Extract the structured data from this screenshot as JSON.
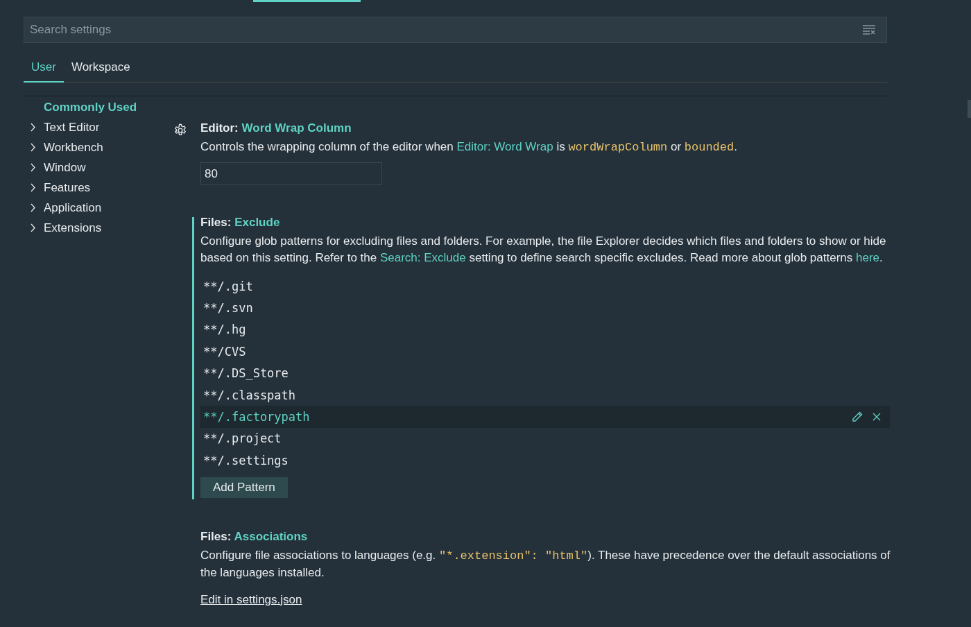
{
  "search": {
    "placeholder": "Search settings"
  },
  "tabs": [
    {
      "label": "User",
      "selected": true
    },
    {
      "label": "Workspace",
      "selected": false
    }
  ],
  "sidebar": {
    "heading": "Commonly Used",
    "items": [
      {
        "label": "Text Editor",
        "expanded": false
      },
      {
        "label": "Workbench",
        "expanded": false
      },
      {
        "label": "Window",
        "expanded": false
      },
      {
        "label": "Features",
        "expanded": false
      },
      {
        "label": "Application",
        "expanded": false
      },
      {
        "label": "Extensions",
        "expanded": false
      }
    ]
  },
  "settings": [
    {
      "kind": "number",
      "category": "Editor:",
      "name": "Word Wrap Column",
      "gear": true,
      "focused": false,
      "description": [
        {
          "kind": "text",
          "text": "Controls the wrapping column of the editor when "
        },
        {
          "kind": "link",
          "text": "Editor: Word Wrap"
        },
        {
          "kind": "text",
          "text": " is "
        },
        {
          "kind": "code",
          "text": "wordWrapColumn"
        },
        {
          "kind": "text",
          "text": " or "
        },
        {
          "kind": "code",
          "text": "bounded"
        },
        {
          "kind": "text",
          "text": "."
        }
      ],
      "value": "80"
    },
    {
      "kind": "list",
      "category": "Files:",
      "name": "Exclude",
      "gear": false,
      "focused": true,
      "description": [
        {
          "kind": "text",
          "text": "Configure glob patterns for excluding files and folders. For example, the file Explorer decides which files and folders to show or hide based on this setting. Refer to the "
        },
        {
          "kind": "link",
          "text": "Search: Exclude"
        },
        {
          "kind": "text",
          "text": " setting to define search specific excludes. Read more about glob patterns "
        },
        {
          "kind": "link",
          "text": "here"
        },
        {
          "kind": "text",
          "text": "."
        }
      ],
      "items": [
        {
          "text": "**/.git",
          "selected": false
        },
        {
          "text": "**/.svn",
          "selected": false
        },
        {
          "text": "**/.hg",
          "selected": false
        },
        {
          "text": "**/CVS",
          "selected": false
        },
        {
          "text": "**/.DS_Store",
          "selected": false
        },
        {
          "text": "**/.classpath",
          "selected": false
        },
        {
          "text": "**/.factorypath",
          "selected": true
        },
        {
          "text": "**/.project",
          "selected": false
        },
        {
          "text": "**/.settings",
          "selected": false
        }
      ],
      "button": "Add Pattern"
    },
    {
      "kind": "json",
      "category": "Files:",
      "name": "Associations",
      "gear": false,
      "focused": false,
      "description": [
        {
          "kind": "text",
          "text": "Configure file associations to languages (e.g. "
        },
        {
          "kind": "code",
          "text": "\"*.extension\": \"html\""
        },
        {
          "kind": "text",
          "text": "). These have precedence over the default associations of the languages installed."
        }
      ],
      "link": "Edit in settings.json"
    }
  ]
}
